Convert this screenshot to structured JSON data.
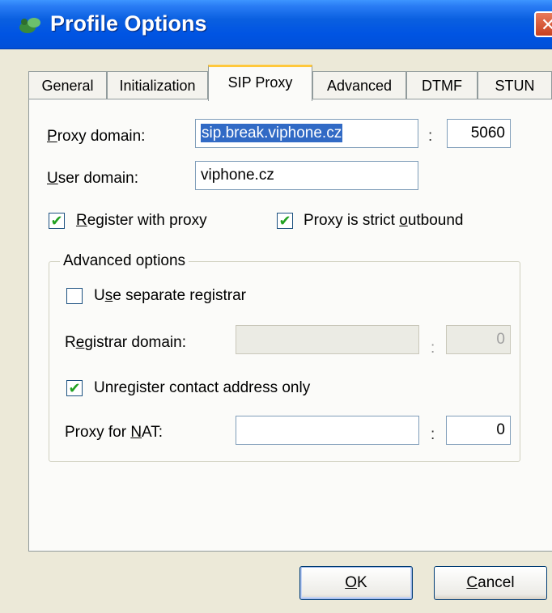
{
  "window": {
    "title": "Profile Options",
    "app_icon": "profile-app-icon",
    "close_glyph": "✕"
  },
  "tabs": [
    {
      "label": "General"
    },
    {
      "label": "Initialization"
    },
    {
      "label": "SIP Proxy"
    },
    {
      "label": "Advanced"
    },
    {
      "label": "DTMF"
    },
    {
      "label": "STUN"
    }
  ],
  "active_tab": "SIP Proxy",
  "proxy": {
    "domain_label_accel": "P",
    "domain_label_rest": "roxy domain:",
    "domain_value": "sip.break.viphone.cz",
    "port_separator": ":",
    "port_value": "5060",
    "user_domain_label_accel": "U",
    "user_domain_label_rest": "ser domain:",
    "user_domain_value": "viphone.cz"
  },
  "checks": {
    "register_accel": "R",
    "register_rest": "egister with proxy",
    "register_checked": true,
    "strict_pre": "Proxy is strict ",
    "strict_accel": "o",
    "strict_rest": "utbound",
    "strict_checked": true,
    "check_glyph": "✔"
  },
  "advanced": {
    "group_title": "Advanced options",
    "separate_pre": "U",
    "separate_accel": "s",
    "separate_rest": "e separate registrar",
    "separate_checked": false,
    "registrar_pre": "R",
    "registrar_accel": "e",
    "registrar_rest": "gistrar domain:",
    "registrar_value": "",
    "registrar_separator": ":",
    "registrar_port": "0",
    "unregister_pre": "Unre",
    "unregister_accel": "g",
    "unregister_rest": "ister contact address only",
    "unregister_checked": true,
    "nat_pre": "Proxy for ",
    "nat_accel": "N",
    "nat_rest": "AT:",
    "nat_value": "",
    "nat_separator": ":",
    "nat_port": "0"
  },
  "buttons": {
    "ok_accel": "O",
    "ok_rest": "K",
    "cancel_accel": "C",
    "cancel_rest": "ancel"
  }
}
